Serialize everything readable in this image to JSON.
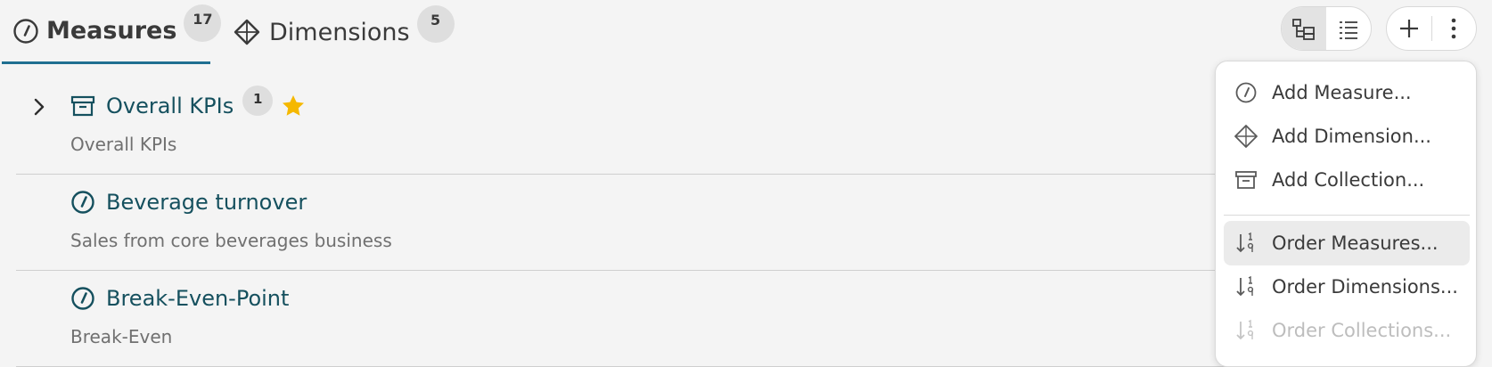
{
  "tabs": {
    "measures": {
      "label": "Measures",
      "count": "17",
      "icon": "gauge-icon"
    },
    "dimensions": {
      "label": "Dimensions",
      "count": "5",
      "icon": "diamond-icon"
    }
  },
  "toolbar": {
    "view_modes": [
      "tree-view-icon",
      "list-view-icon"
    ],
    "active_view": "tree-view-icon",
    "actions": [
      "plus-icon",
      "more-vertical-icon"
    ]
  },
  "list": {
    "items": [
      {
        "title": "Overall KPIs",
        "description": "Overall KPIs",
        "count": "1",
        "type": "collection",
        "starred": true,
        "expandable": true
      },
      {
        "title": "Beverage turnover",
        "description": "Sales from core beverages business",
        "type": "measure"
      },
      {
        "title": "Break-Even-Point",
        "description": "Break-Even",
        "type": "measure"
      }
    ]
  },
  "menu": {
    "items": [
      {
        "label": "Add Measure...",
        "icon": "gauge-icon"
      },
      {
        "label": "Add Dimension...",
        "icon": "diamond-icon"
      },
      {
        "label": "Add Collection...",
        "icon": "archive-box-icon"
      },
      {
        "label": "Order Measures...",
        "icon": "sort-icon",
        "highlighted": true
      },
      {
        "label": "Order Dimensions...",
        "icon": "sort-icon"
      },
      {
        "label": "Order Collections...",
        "icon": "sort-icon",
        "disabled": true
      }
    ]
  },
  "colors": {
    "accent": "#1f6f91",
    "title_text": "#15505e",
    "star": "#f5b800",
    "background": "#f4f4f4"
  }
}
